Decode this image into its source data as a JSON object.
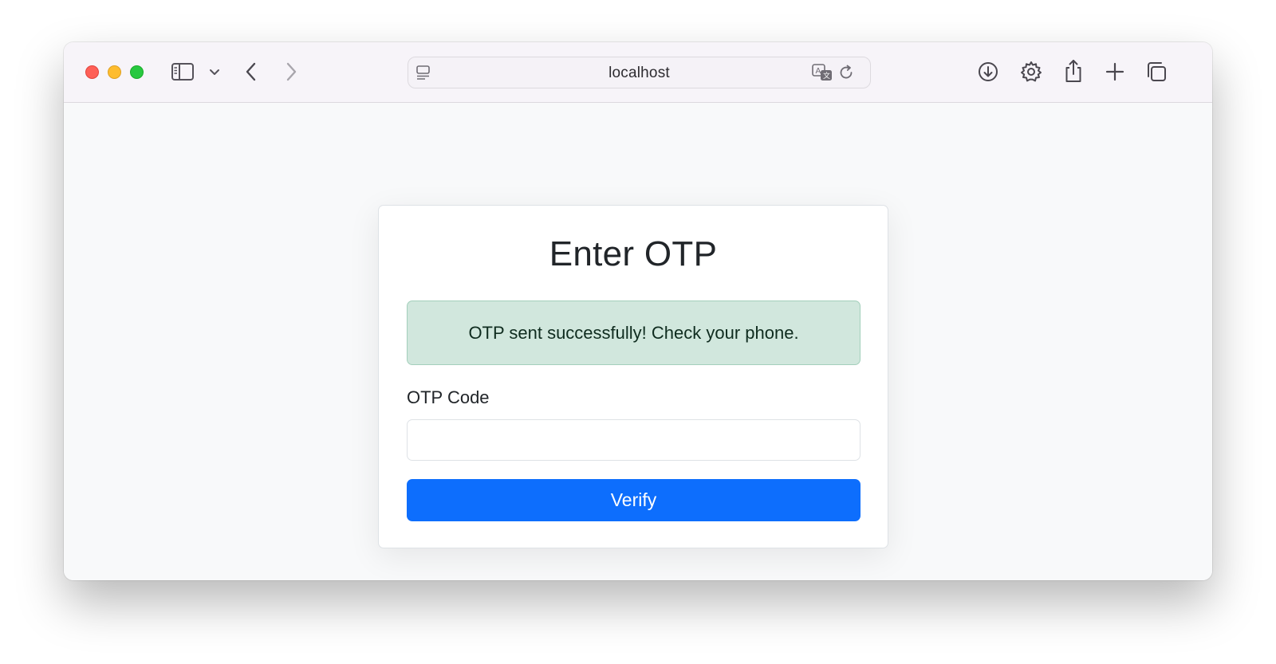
{
  "browser": {
    "url": "localhost",
    "icons": {
      "close": "close-traffic-light",
      "minimize": "minimize-traffic-light",
      "maximize": "maximize-traffic-light",
      "sidebar": "sidebar-icon",
      "sidebar_menu": "chevron-down-icon",
      "back": "chevron-left-icon",
      "forward": "chevron-right-icon",
      "page": "page-icon",
      "translate": "translate-icon",
      "reload": "reload-icon",
      "downloads": "download-icon",
      "settings": "gear-icon",
      "share": "share-icon",
      "new_tab": "plus-icon",
      "tabs": "tabs-overview-icon"
    },
    "colors": {
      "close": "#fe5f57",
      "minimize": "#febc2e",
      "maximize": "#28c840"
    }
  },
  "page": {
    "title": "Enter OTP",
    "alert": {
      "message": "OTP sent successfully! Check your phone.",
      "color": "#d1e7dd"
    },
    "otp_field": {
      "label": "OTP Code",
      "value": "",
      "placeholder": ""
    },
    "verify_button": {
      "label": "Verify",
      "color": "#0d6efd"
    }
  }
}
